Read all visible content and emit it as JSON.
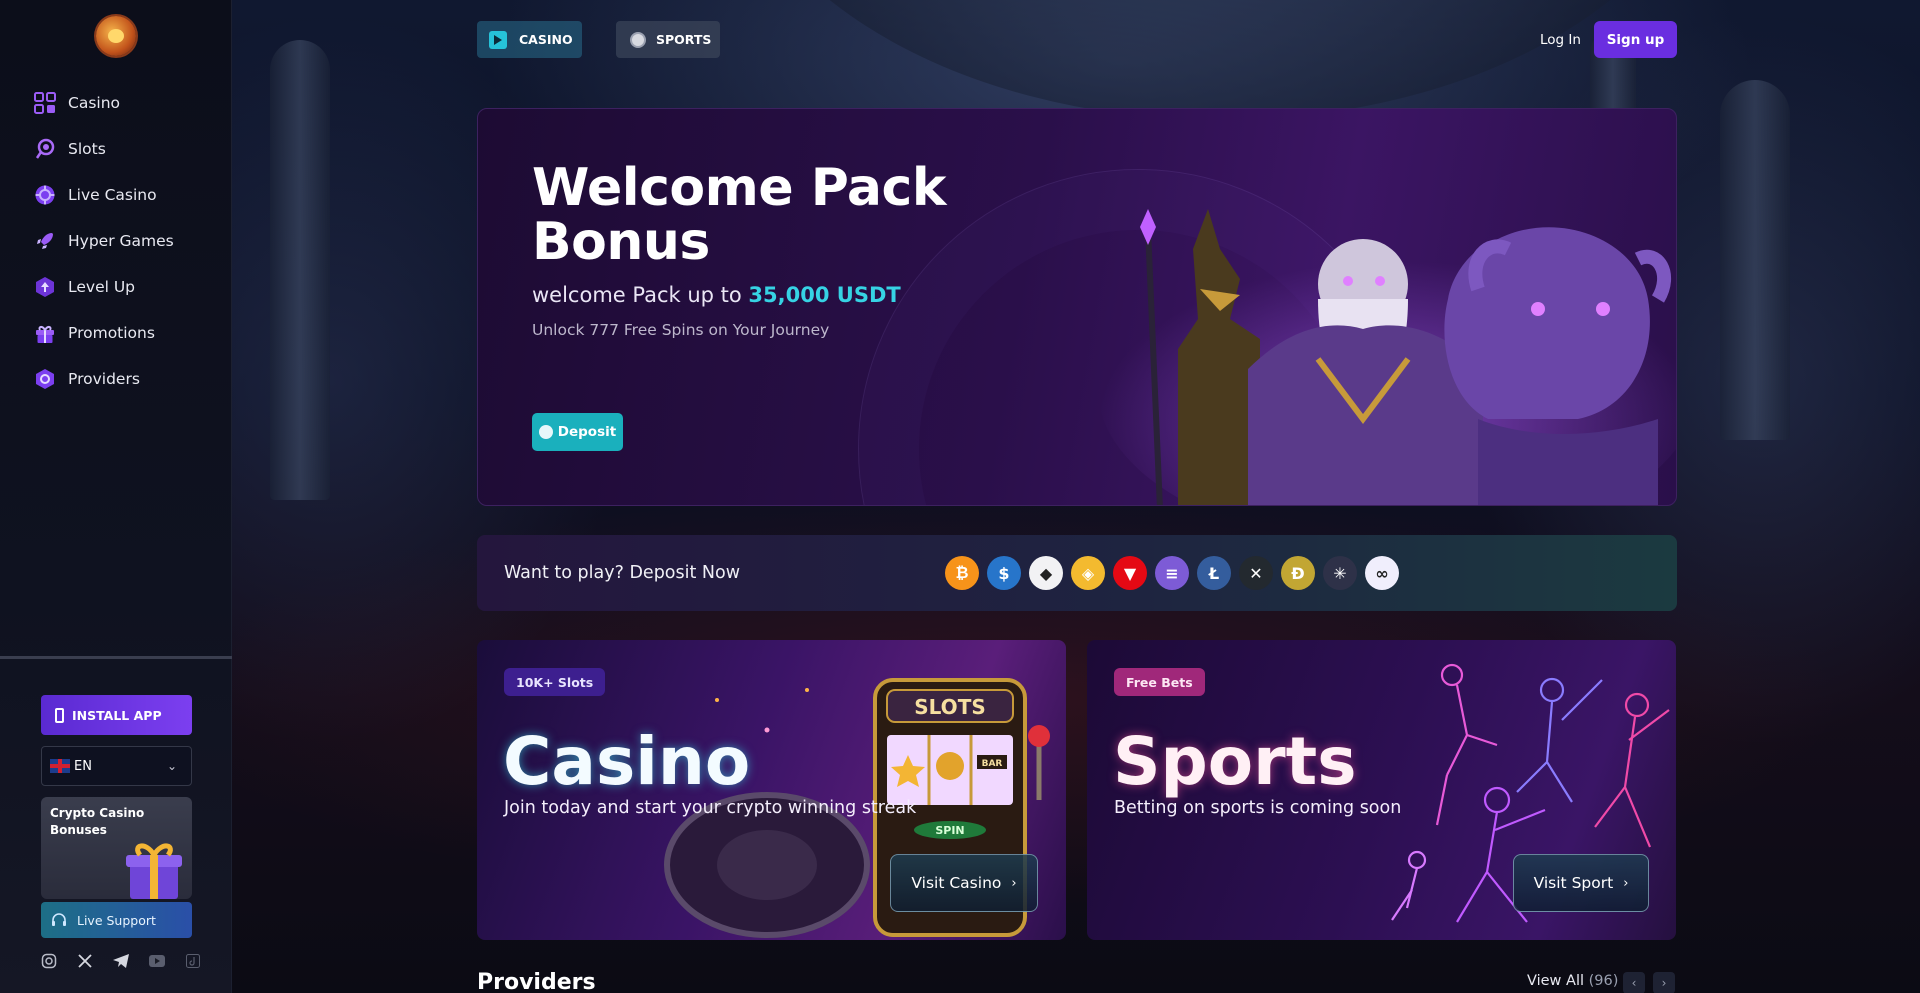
{
  "sidebar": {
    "items": [
      {
        "label": "Casino",
        "icon": "grid-icon"
      },
      {
        "label": "Slots",
        "icon": "lollipop-icon"
      },
      {
        "label": "Live Casino",
        "icon": "casino-chip-icon"
      },
      {
        "label": "Hyper Games",
        "icon": "rocket-icon"
      },
      {
        "label": "Level Up",
        "icon": "level-up-icon"
      },
      {
        "label": "Promotions",
        "icon": "gift-icon"
      },
      {
        "label": "Providers",
        "icon": "providers-icon"
      }
    ],
    "install_label": "INSTALL APP",
    "language": "EN",
    "bonus_card_title": "Crypto Casino Bonuses",
    "live_support_label": "Live Support",
    "socials": [
      "instagram-icon",
      "x-icon",
      "telegram-icon",
      "youtube-icon",
      "tiktok-icon"
    ]
  },
  "topbar": {
    "tab_casino": "CASINO",
    "tab_sports": "SPORTS",
    "login": "Log In",
    "signup": "Sign up"
  },
  "hero": {
    "title": "Welcome Pack Bonus",
    "subtitle_prefix": "welcome Pack up to ",
    "subtitle_amount": "35,000 USDT",
    "subtitle2": "Unlock 777 Free Spins on Your Journey",
    "deposit_label": "Deposit"
  },
  "deposit_strip": {
    "text": "Want to play? Deposit Now",
    "coins": [
      {
        "name": "bitcoin-icon",
        "glyph": "₿",
        "color": "#f7931a"
      },
      {
        "name": "usdc-icon",
        "glyph": "$",
        "color": "#2775ca"
      },
      {
        "name": "ethereum-icon",
        "glyph": "◆",
        "color": "#f2f2f4"
      },
      {
        "name": "bnb-icon",
        "glyph": "◈",
        "color": "#f3ba2f"
      },
      {
        "name": "tron-icon",
        "glyph": "▼",
        "color": "#e50914"
      },
      {
        "name": "solana-icon",
        "glyph": "≡",
        "color": "#7d5bd6"
      },
      {
        "name": "litecoin-icon",
        "glyph": "Ł",
        "color": "#345d9d"
      },
      {
        "name": "xrp-icon",
        "glyph": "✕",
        "color": "#23292f"
      },
      {
        "name": "dogecoin-icon",
        "glyph": "Ð",
        "color": "#c2a633"
      },
      {
        "name": "cosmos-icon",
        "glyph": "✳",
        "color": "#2e3148"
      },
      {
        "name": "polygon-icon",
        "glyph": "∞",
        "color": "#f0eefc"
      }
    ]
  },
  "cards": {
    "casino": {
      "badge": "10K+ Slots",
      "title": "Casino",
      "desc": "Join today and start your crypto winning streak",
      "button": "Visit Casino"
    },
    "sports": {
      "badge": "Free Bets",
      "title": "Sports",
      "desc": "Betting on sports is coming soon",
      "button": "Visit Sport"
    }
  },
  "providers": {
    "title": "Providers",
    "view_all": "View All",
    "count": "(96)"
  }
}
